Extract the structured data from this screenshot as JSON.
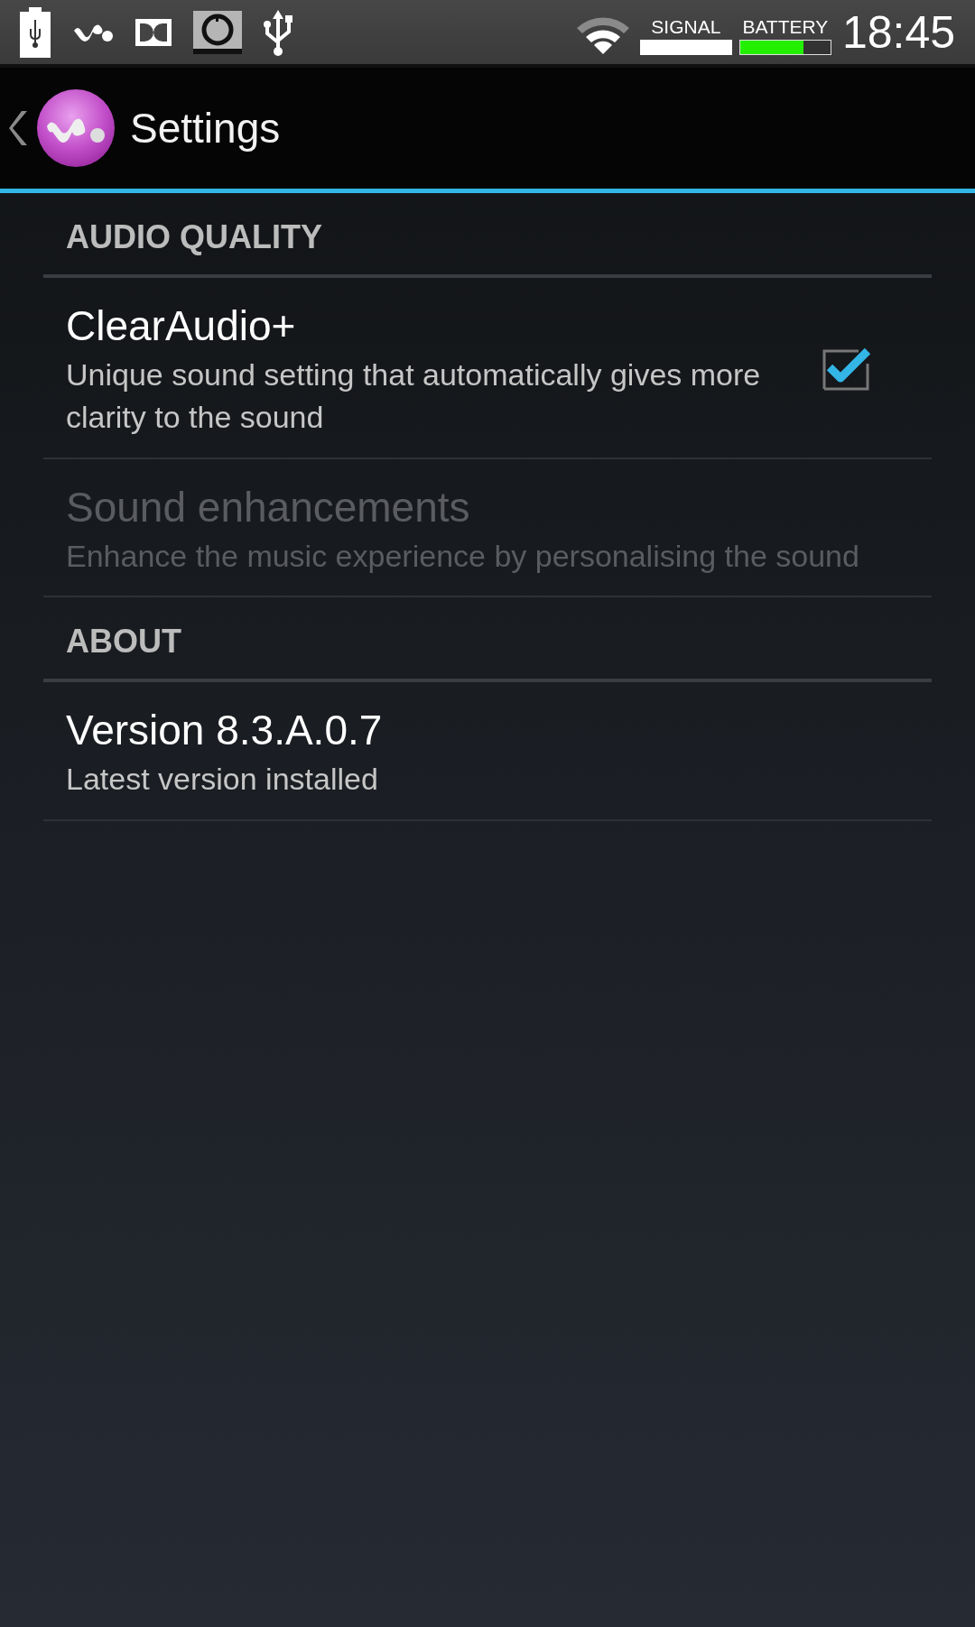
{
  "status_bar": {
    "signal_label": "SIGNAL",
    "battery_label": "BATTERY",
    "time": "18:45"
  },
  "header": {
    "title": "Settings"
  },
  "sections": [
    {
      "title": "AUDIO QUALITY",
      "items": [
        {
          "kind": "checkbox",
          "title": "ClearAudio+",
          "summary": "Unique sound setting that automatically gives more clarity to the sound",
          "checked": true,
          "disabled": false
        },
        {
          "kind": "plain",
          "title": "Sound enhancements",
          "summary": "Enhance the music experience by personalising the sound",
          "disabled": true
        }
      ]
    },
    {
      "title": "ABOUT",
      "items": [
        {
          "kind": "plain",
          "title": "Version 8.3.A.0.7",
          "summary": "Latest version installed",
          "disabled": false
        }
      ]
    }
  ]
}
